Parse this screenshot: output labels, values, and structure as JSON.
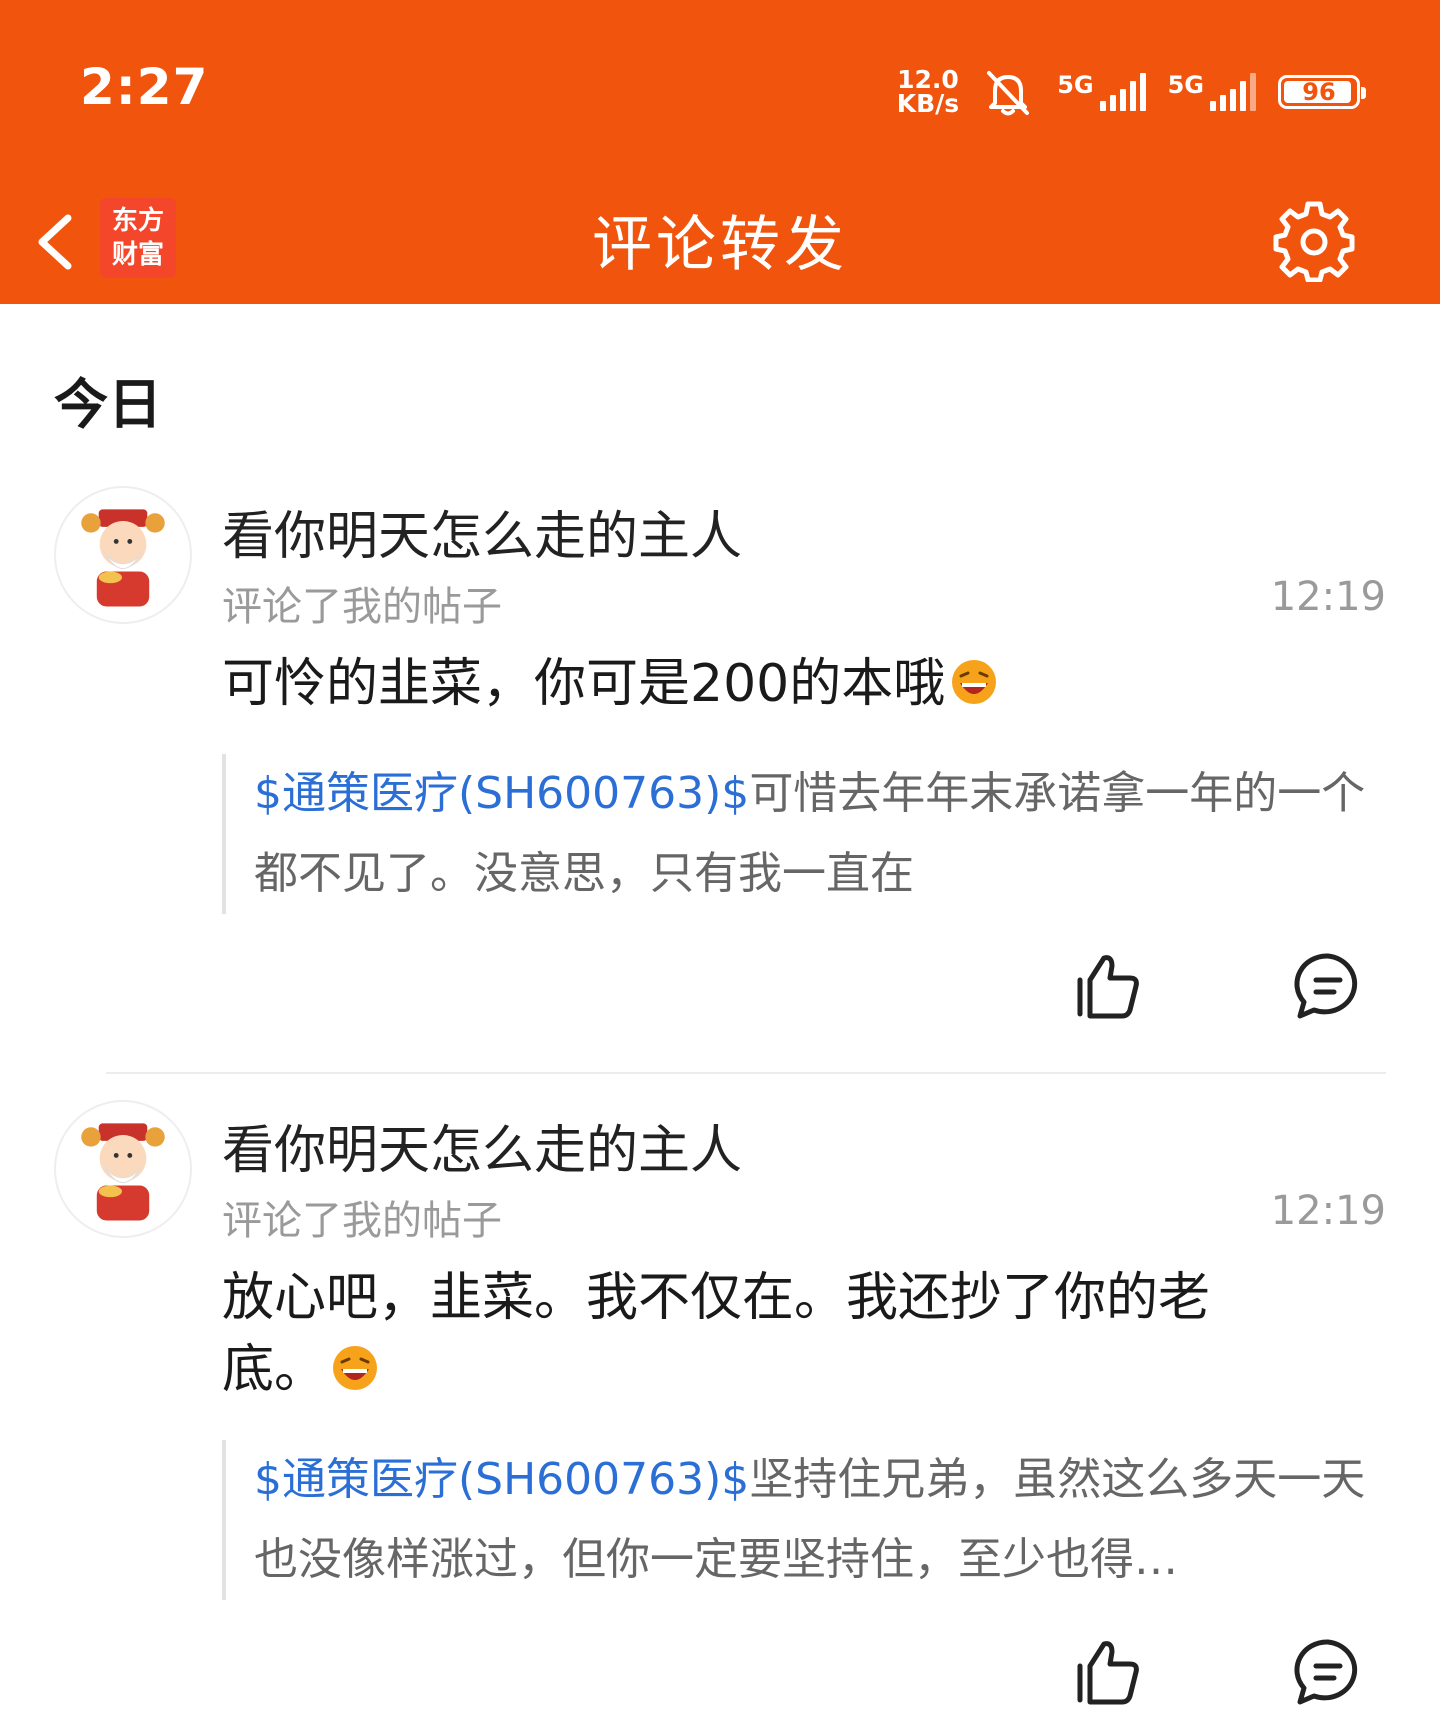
{
  "status_bar": {
    "time": "2:27",
    "net_speed_value": "12.0",
    "net_speed_unit": "KB/s",
    "sim1_label": "5G",
    "sim2_label": "5G",
    "battery": "96",
    "battery_level": 0.96
  },
  "nav": {
    "logo_line1": "东方",
    "logo_line2": "财富",
    "title": "评论转发"
  },
  "section_title": "今日",
  "notifications": [
    {
      "username": "看你明天怎么走的主人",
      "action": "评论了我的帖子",
      "time": "12:19",
      "comment": "可怜的韭菜，你可是200的本哦",
      "quote_tag": "$通策医疗(SH600763)$",
      "quote_text": "可惜去年年末承诺拿一年的一个都不见了。没意思，只有我一直在"
    },
    {
      "username": "看你明天怎么走的主人",
      "action": "评论了我的帖子",
      "time": "12:19",
      "comment": "放心吧，韭菜。我不仅在。我还抄了你的老底。",
      "quote_tag": "$通策医疗(SH600763)$",
      "quote_text": "坚持住兄弟，虽然这么多天一天也没像样涨过，但你一定要坚持住，至少也得…"
    }
  ],
  "colors": {
    "brand": "#f0540d",
    "link": "#2b6fd6",
    "muted": "#9a9a9a"
  }
}
